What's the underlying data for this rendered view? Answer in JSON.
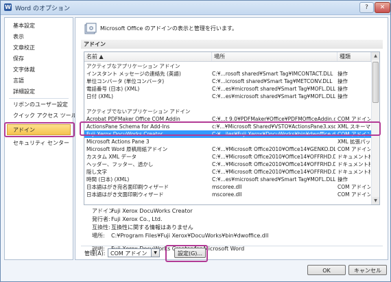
{
  "window": {
    "title": "Word のオプション",
    "help_label": "?",
    "close_label": "✕",
    "app_icon_letter": "W"
  },
  "sidebar": {
    "items": [
      {
        "label": "基本設定"
      },
      {
        "label": "表示"
      },
      {
        "label": "文章校正"
      },
      {
        "label": "保存"
      },
      {
        "label": "文字体裁"
      },
      {
        "label": "言語"
      },
      {
        "label": "詳細設定"
      },
      {
        "label": "リボンのユーザー設定"
      },
      {
        "label": "クイック アクセス ツール バー"
      },
      {
        "label": "アドイン"
      },
      {
        "label": "セキュリティ センター"
      }
    ],
    "selected_index": 9
  },
  "main": {
    "header_text": "Microsoft Office のアドインの表示と管理を行います。",
    "section_title": "アドイン",
    "columns": {
      "name": "名前 ▲",
      "location": "場所",
      "type": "種類"
    },
    "rows": [
      {
        "name": "アクティブなアプリケーション アドイン",
        "location": "",
        "type": "",
        "group": true
      },
      {
        "name": "インスタント メッセージの連絡先 (英語)",
        "location": "C:¥...rosoft shared¥Smart Tag¥IMCONTACT.DLL",
        "type": "操作"
      },
      {
        "name": "単位コンバータ (単位コンバータ)",
        "location": "C:¥...icrosoft shared¥Smart Tag¥METCONV.DLL",
        "type": "操作"
      },
      {
        "name": "電話番号 (日本) (XML)",
        "location": "C:¥...es¥microsoft shared¥Smart Tag¥MOFL.DLL",
        "type": "操作"
      },
      {
        "name": "日付 (XML)",
        "location": "C:¥...es¥microsoft shared¥Smart Tag¥MOFL.DLL",
        "type": "操作"
      },
      {
        "name": "",
        "location": "",
        "type": "",
        "spacer": true
      },
      {
        "name": "アクティブでないアプリケーション アドイン",
        "location": "",
        "type": "",
        "group": true
      },
      {
        "name": "Acrobat PDFMaker Office COM Addin",
        "location": "C:¥...t 9.0¥PDFMaker¥Office¥PDFMOfficeAddin.dll",
        "type": "COM アドイン"
      },
      {
        "name": "ActionsPane Schema for Add-Ins",
        "location": "c:¥...¥Microsoft Shared¥VSTO¥ActionsPane3.xsd",
        "type": "XML スキーマ"
      },
      {
        "name": "Fuji Xerox DocuWorks Creator",
        "location": "C:¥...iles¥Fuji Xerox¥DocuWorks¥bin¥dwoffice.dll",
        "type": "COM アドイン",
        "selected": true
      },
      {
        "name": "Microsoft Actions Pane 3",
        "location": "",
        "type": "XML 拡張パック"
      },
      {
        "name": "Microsoft Word 原稿用紙アドイン",
        "location": "C:¥...¥Microsoft Office2010¥Office14¥GENKO.DLL",
        "type": "COM アドイン"
      },
      {
        "name": "カスタム XML データ",
        "location": "C:¥...¥Microsoft Office2010¥Office14¥OFFRHD.DLL",
        "type": "ドキュメント検査"
      },
      {
        "name": "ヘッダー、フッター、透かし",
        "location": "C:¥...¥Microsoft Office2010¥Office14¥OFFRHD.DLL",
        "type": "ドキュメント検査"
      },
      {
        "name": "隠し文字",
        "location": "C:¥...¥Microsoft Office2010¥Office14¥OFFRHD.DLL",
        "type": "ドキュメント検査"
      },
      {
        "name": "時間 (日本) (XML)",
        "location": "C:¥...es¥microsoft shared¥Smart Tag¥MOFL.DLL",
        "type": "操作"
      },
      {
        "name": "日本語はがき宛名面印刷ウィザード",
        "location": "mscoree.dll",
        "type": "COM アドイン"
      },
      {
        "name": "日本語はがき文面印刷ウィザード",
        "location": "mscoree.dll",
        "type": "COM アドイン"
      }
    ],
    "details": {
      "addin_label": "アドイン:",
      "addin_value": "Fuji Xerox DocuWorks Creator",
      "publisher_label": "発行者:",
      "publisher_value": "Fuji Xerox Co., Ltd.",
      "compat_label": "互換性:",
      "compat_value": "互換性に関する情報はありません",
      "location_label": "場所:",
      "location_value": "C:¥Program Files¥Fuji Xerox¥DocuWorks¥bin¥dwoffice.dll",
      "description_label": "説明:",
      "description_value": "Fuji Xerox DocuWorks Creator for Microsoft Word"
    },
    "manage": {
      "label": "管理(A):",
      "selected": "COM アドイン",
      "go_label": "設定(G)..."
    }
  },
  "footer": {
    "ok_label": "OK",
    "cancel_label": "キャンセル"
  },
  "colors": {
    "selection": "#3399ff",
    "highlight_box": "#b23a95",
    "nav_selected": "#f6c24f"
  }
}
